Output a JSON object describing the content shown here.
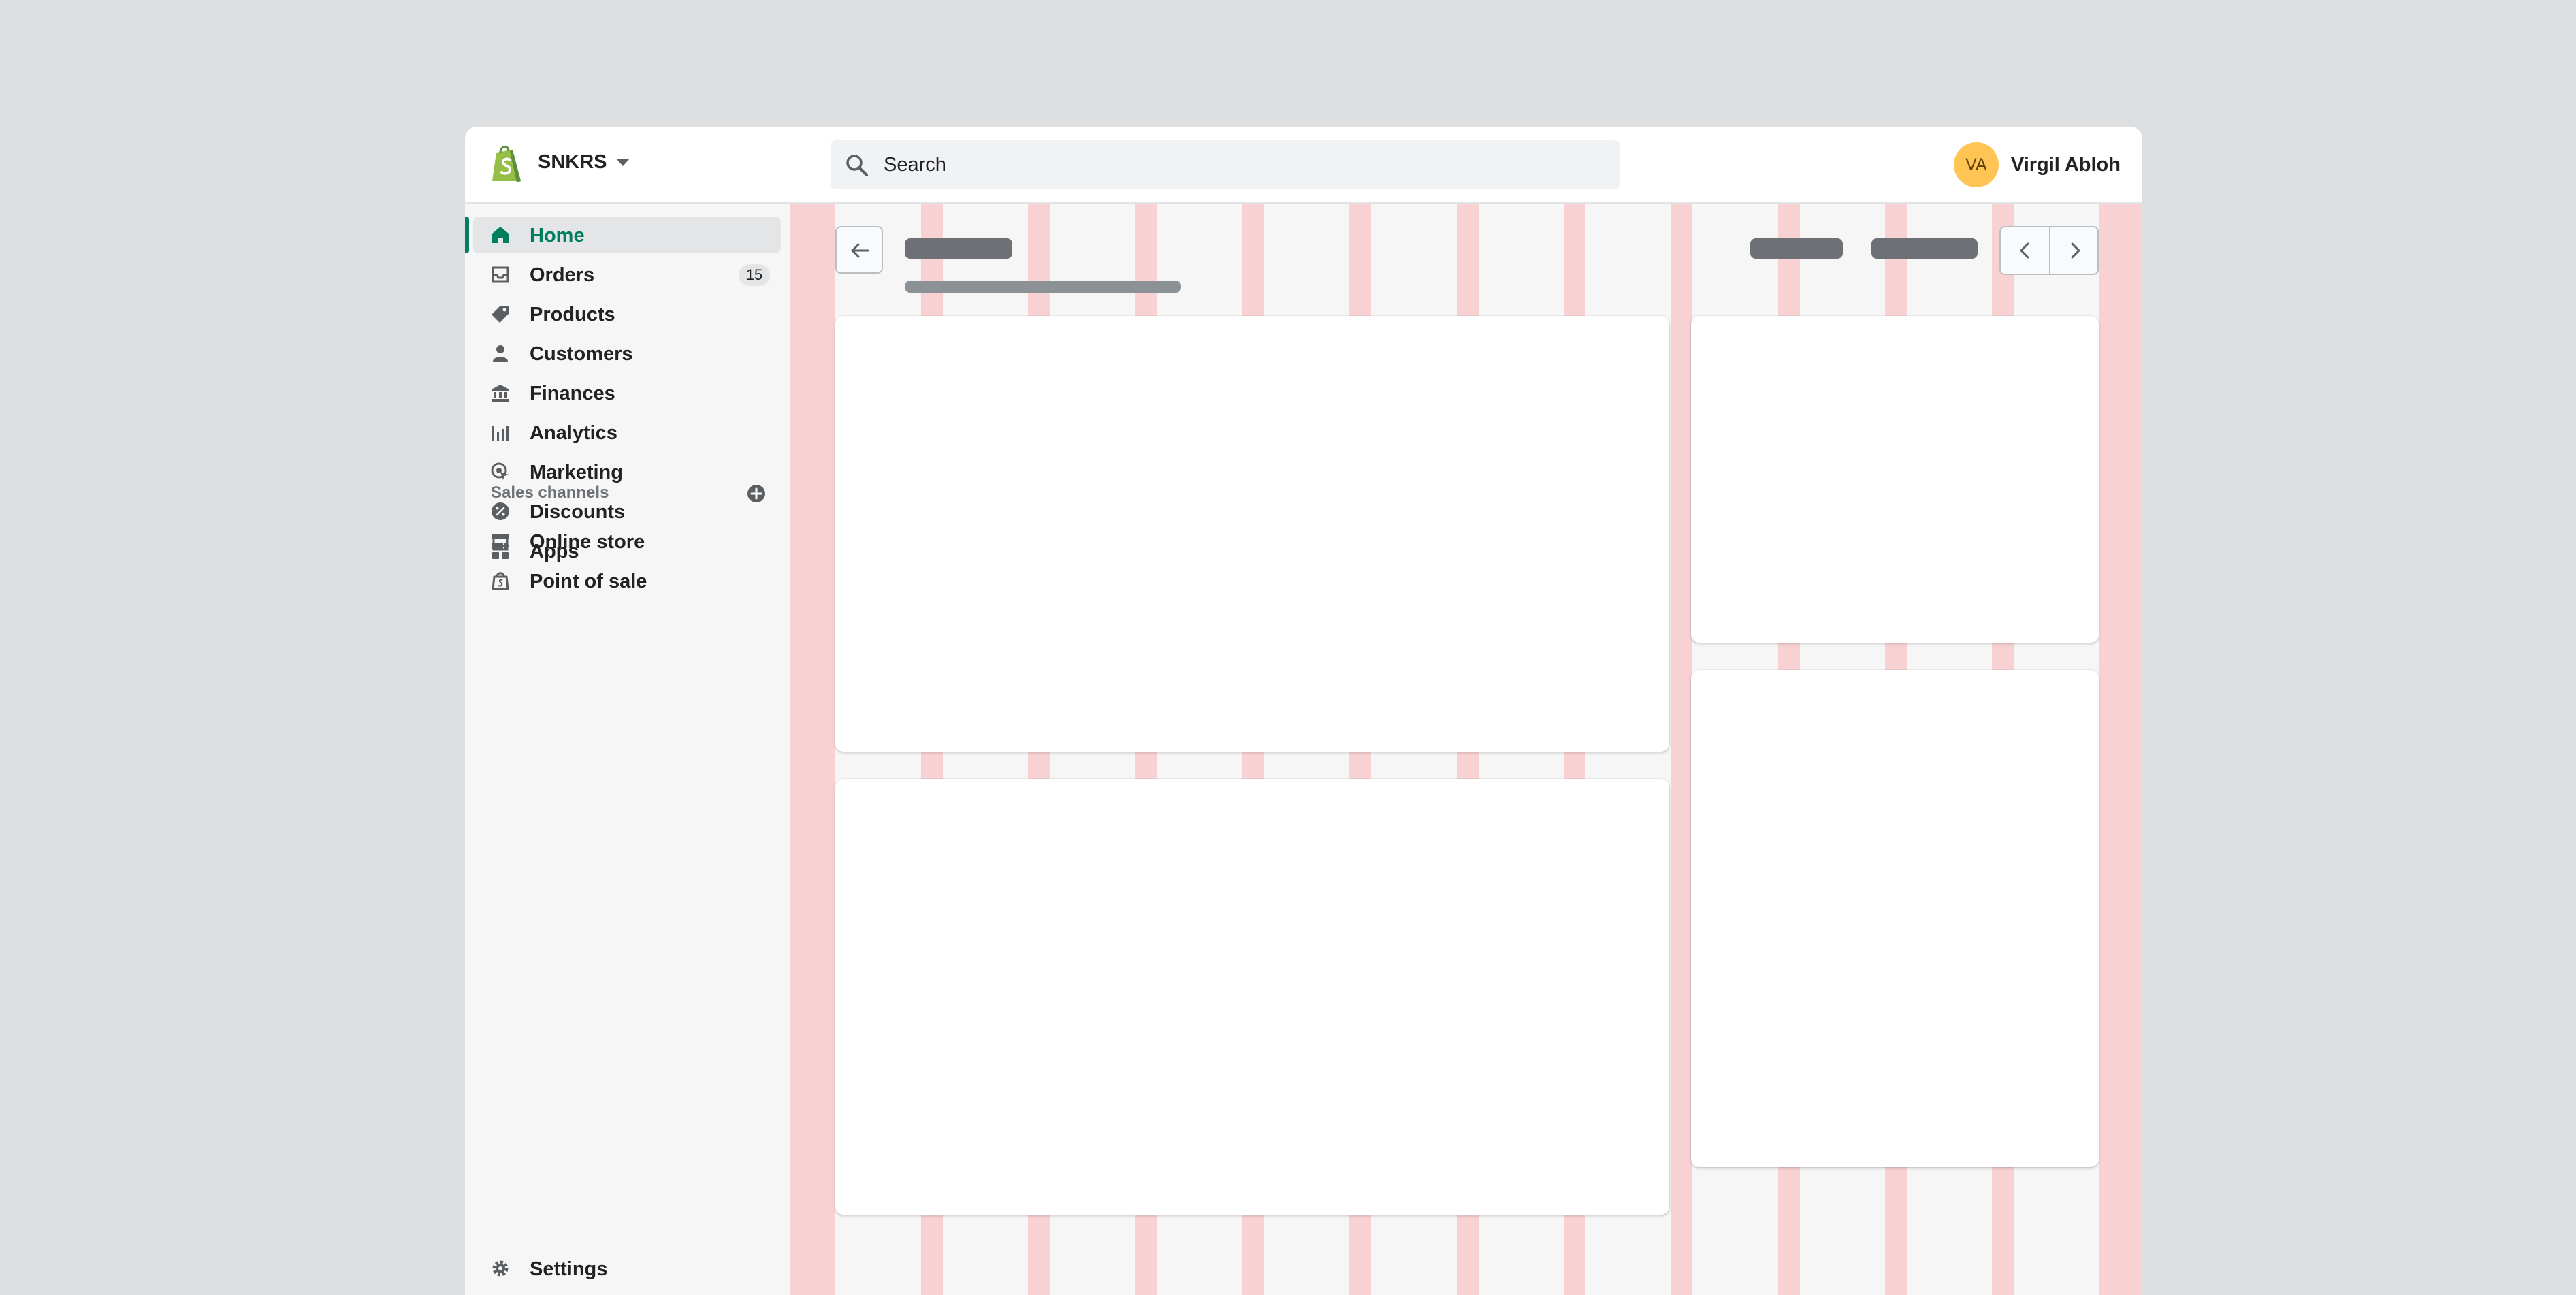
{
  "store": {
    "name": "SNKRS"
  },
  "search": {
    "placeholder": "Search"
  },
  "user": {
    "initials": "VA",
    "name": "Virgil Abloh"
  },
  "nav": {
    "items": [
      {
        "id": "home",
        "label": "Home",
        "icon": "home-icon",
        "active": true
      },
      {
        "id": "orders",
        "label": "Orders",
        "icon": "orders-icon",
        "badge": "15"
      },
      {
        "id": "products",
        "label": "Products",
        "icon": "tag-icon"
      },
      {
        "id": "customers",
        "label": "Customers",
        "icon": "person-icon"
      },
      {
        "id": "finances",
        "label": "Finances",
        "icon": "bank-icon"
      },
      {
        "id": "analytics",
        "label": "Analytics",
        "icon": "bar-chart-icon"
      },
      {
        "id": "marketing",
        "label": "Marketing",
        "icon": "marketing-icon"
      },
      {
        "id": "discounts",
        "label": "Discounts",
        "icon": "discount-icon"
      },
      {
        "id": "apps",
        "label": "Apps",
        "icon": "apps-icon"
      }
    ],
    "sales_channels_title": "Sales channels",
    "channels": [
      {
        "id": "online-store",
        "label": "Online store",
        "icon": "store-icon"
      },
      {
        "id": "point-of-sale",
        "label": "Point of sale",
        "icon": "pos-bag-icon"
      }
    ],
    "settings_label": "Settings"
  },
  "colors": {
    "brand_green": "#008060",
    "active_text": "#007f5f",
    "avatar_bg": "#ffc453",
    "grid_overlay": "#ff7878",
    "skeleton_dark": "#6d7175",
    "skeleton_light": "#8c9196"
  }
}
